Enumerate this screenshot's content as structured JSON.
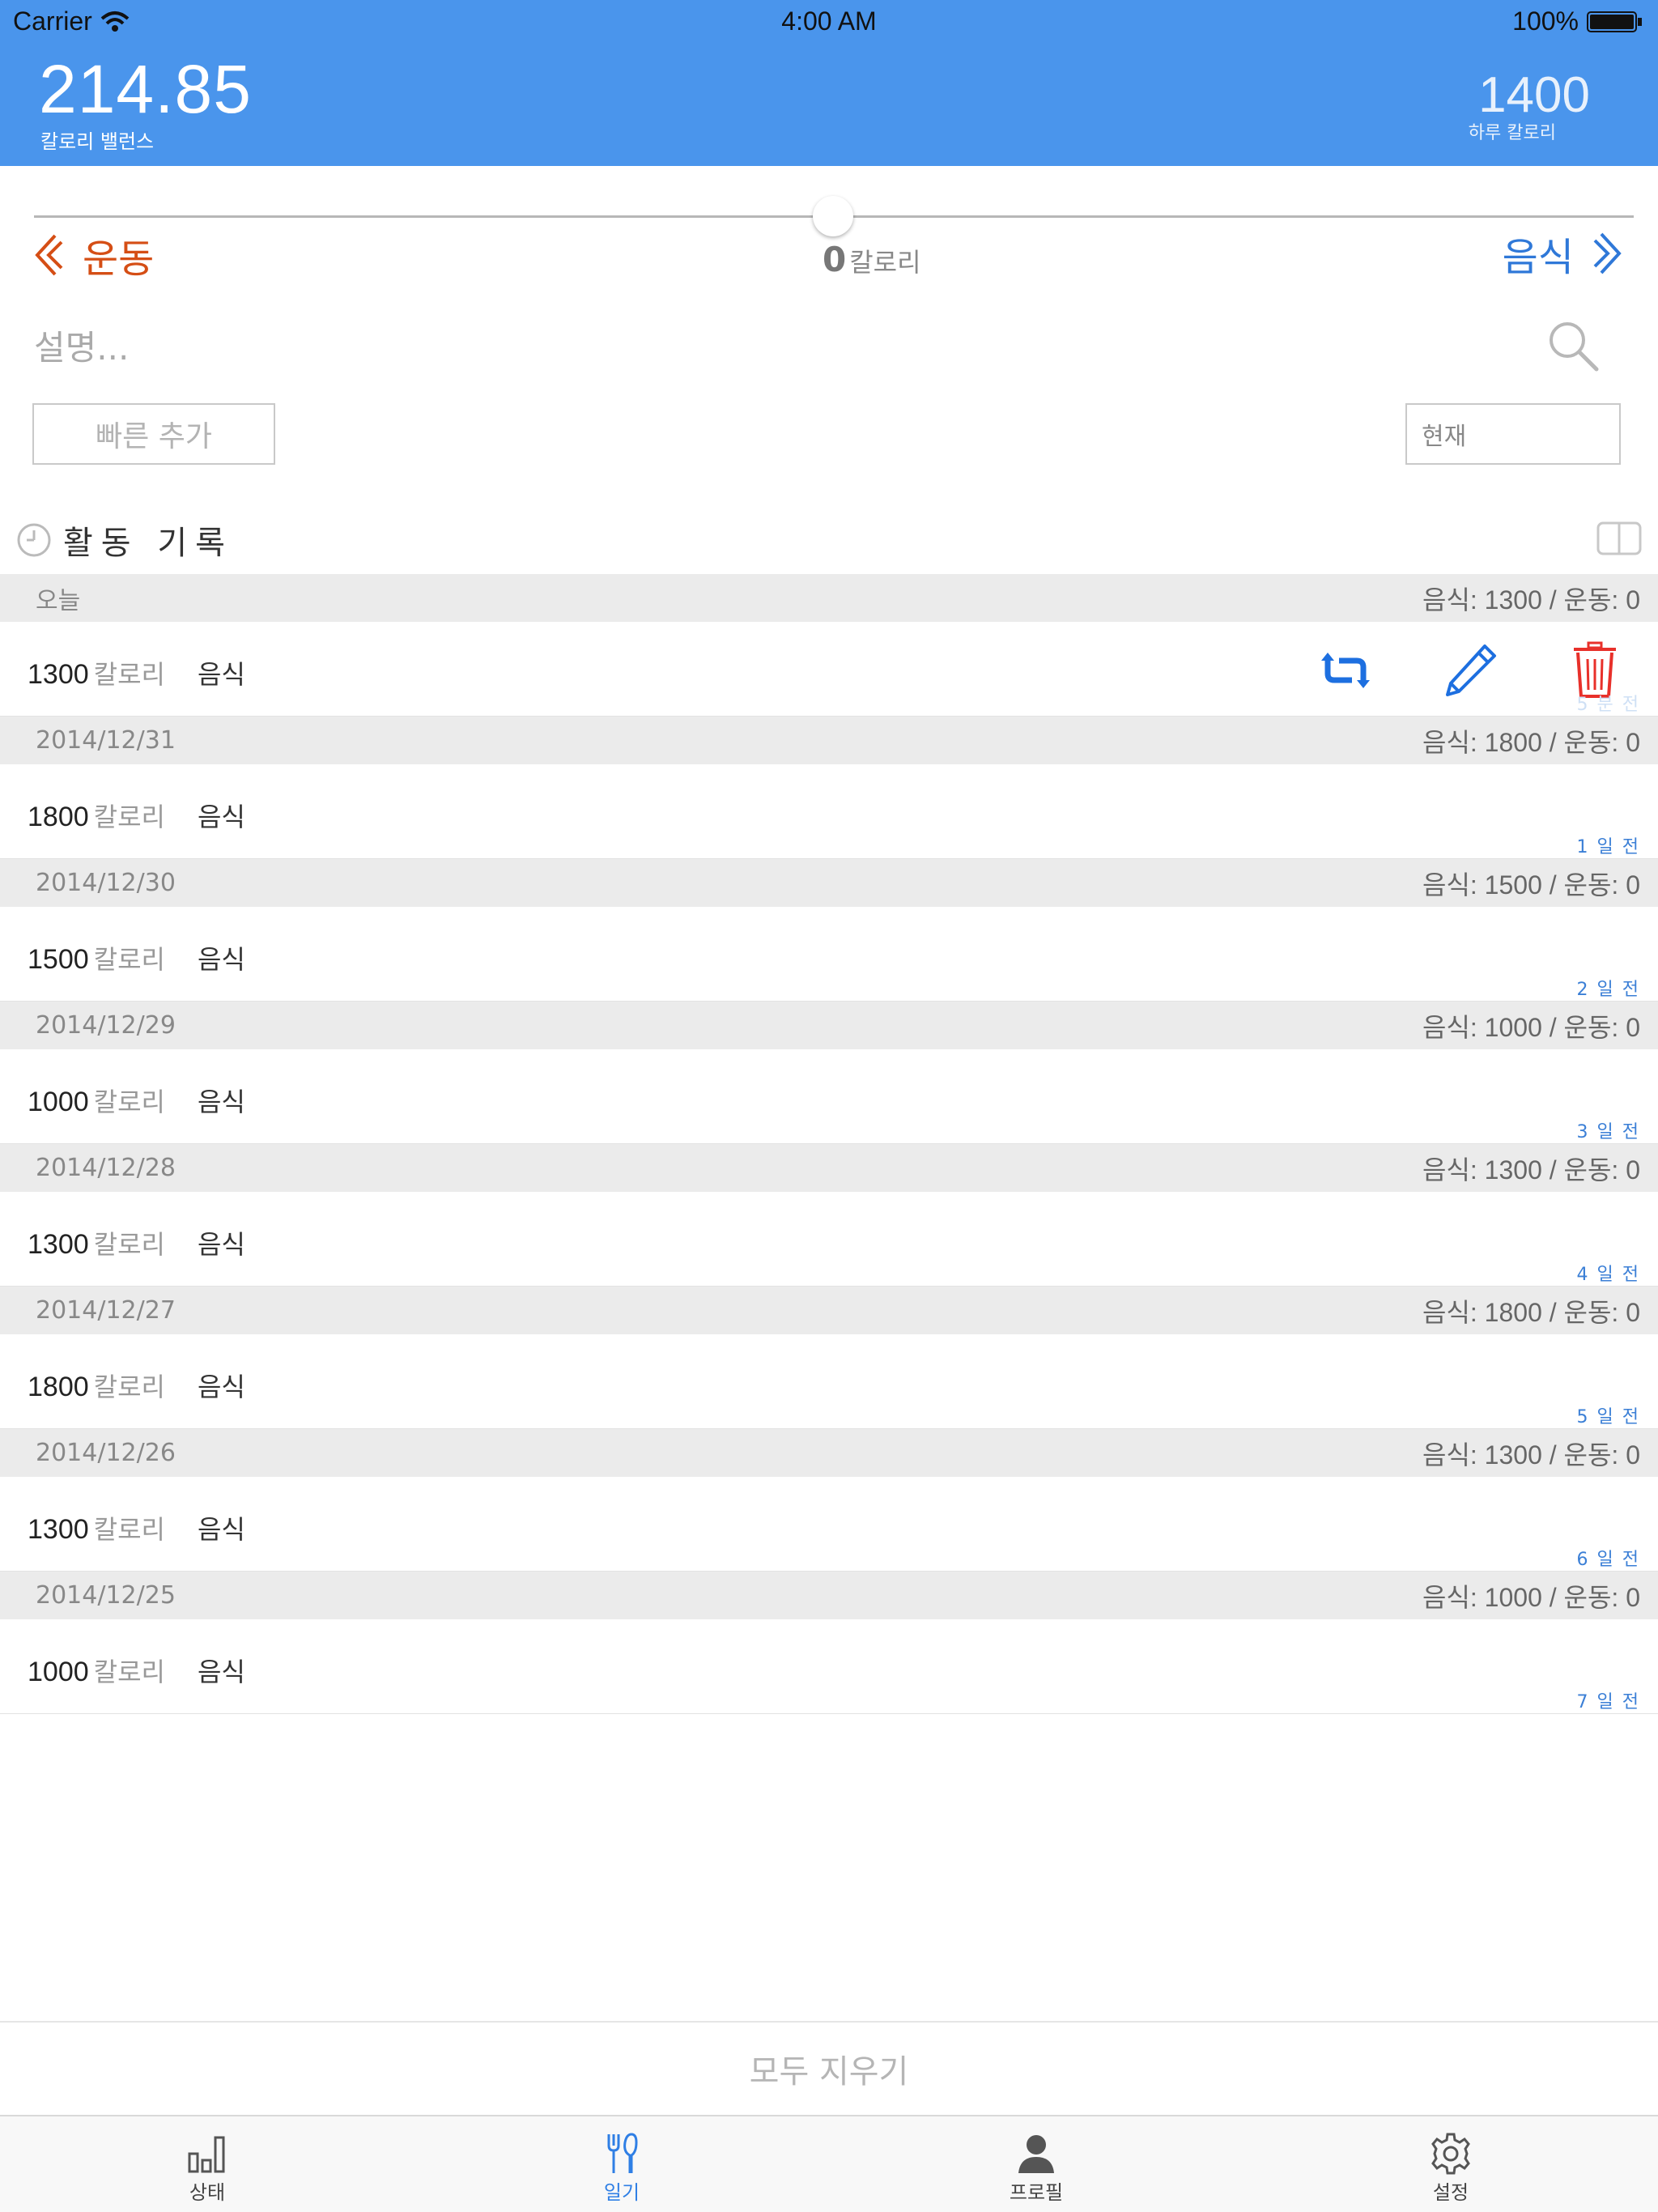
{
  "status_bar": {
    "carrier": "Carrier",
    "time": "4:00 AM",
    "battery": "100%"
  },
  "header": {
    "balance_value": "214.85",
    "balance_label": "칼로리 밸런스",
    "daily_value": "1400",
    "daily_label": "하루 칼로리"
  },
  "slider": {
    "left_label": "운동",
    "right_label": "음식",
    "value": "0",
    "unit": "칼로리",
    "position_fraction": 0.5
  },
  "input": {
    "description_placeholder": "설명...",
    "quick_add_label": "빠른 추가",
    "time_value": "현재"
  },
  "log": {
    "title": "활동 기록",
    "days": [
      {
        "date": "오늘",
        "summary": "음식: 1300 / 운동: 0",
        "calories": "1300",
        "unit": "칼로리",
        "type": "음식",
        "ago": "5 분 전",
        "selected": true
      },
      {
        "date": "2014/12/31",
        "summary": "음식: 1800 / 운동: 0",
        "calories": "1800",
        "unit": "칼로리",
        "type": "음식",
        "ago": "1 일 전"
      },
      {
        "date": "2014/12/30",
        "summary": "음식: 1500 / 운동: 0",
        "calories": "1500",
        "unit": "칼로리",
        "type": "음식",
        "ago": "2 일 전"
      },
      {
        "date": "2014/12/29",
        "summary": "음식: 1000 / 운동: 0",
        "calories": "1000",
        "unit": "칼로리",
        "type": "음식",
        "ago": "3 일 전"
      },
      {
        "date": "2014/12/28",
        "summary": "음식: 1300 / 운동: 0",
        "calories": "1300",
        "unit": "칼로리",
        "type": "음식",
        "ago": "4 일 전"
      },
      {
        "date": "2014/12/27",
        "summary": "음식: 1800 / 운동: 0",
        "calories": "1800",
        "unit": "칼로리",
        "type": "음식",
        "ago": "5 일 전"
      },
      {
        "date": "2014/12/26",
        "summary": "음식: 1300 / 운동: 0",
        "calories": "1300",
        "unit": "칼로리",
        "type": "음식",
        "ago": "6 일 전"
      },
      {
        "date": "2014/12/25",
        "summary": "음식: 1000 / 운동: 0",
        "calories": "1000",
        "unit": "칼로리",
        "type": "음식",
        "ago": "7 일 전"
      }
    ]
  },
  "clear_all_label": "모두 지우기",
  "tabs": [
    {
      "label": "상태",
      "icon": "bar-chart-icon",
      "active": false
    },
    {
      "label": "일기",
      "icon": "fork-knife-icon",
      "active": true
    },
    {
      "label": "프로필",
      "icon": "person-icon",
      "active": false
    },
    {
      "label": "설정",
      "icon": "gear-icon",
      "active": false
    }
  ],
  "colors": {
    "header": "#4a95ec",
    "exercise": "#d54e15",
    "food": "#2f78d8",
    "delete": "#e8302a",
    "tab_active": "#2f7fe5"
  }
}
